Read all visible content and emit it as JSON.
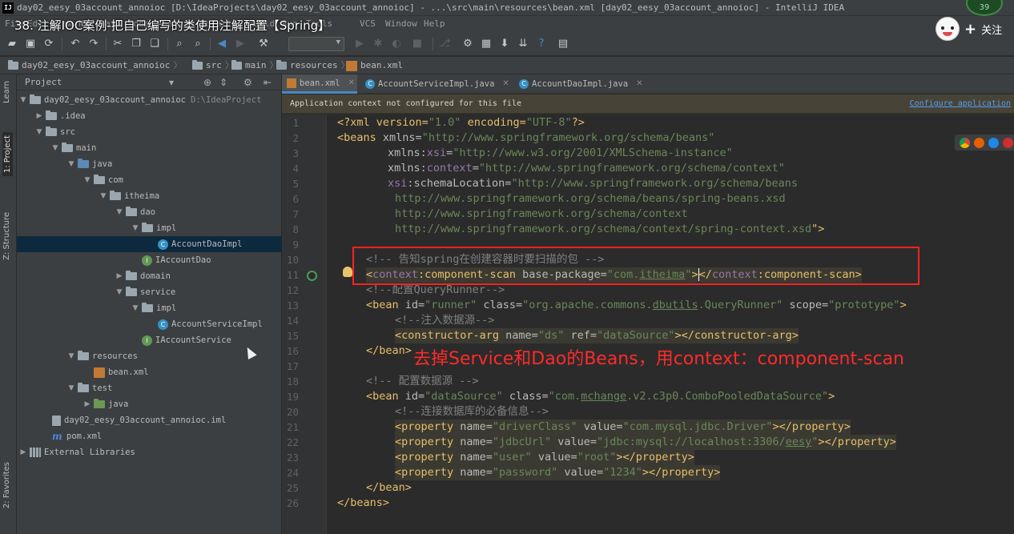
{
  "window": {
    "title": "day02_eesy_03account_annoioc [D:\\IdeaProjects\\day02_eesy_03account_annoioc] - ...\\src\\main\\resources\\bean.xml [day02_eesy_03account_annoioc] - IntelliJ IDEA"
  },
  "video": {
    "title": "38. 注解IOC案例-把自己编写的类使用注解配置【Spring】",
    "follow_plus": "+",
    "follow_label": "关注",
    "badge": "39"
  },
  "menu": [
    "File",
    "Edit",
    "View",
    "Navigate",
    "Code",
    "Analyze",
    "Refactor",
    "Build",
    "Run",
    "Tools",
    "VCS",
    "Window",
    "Help"
  ],
  "breadcrumb": [
    "day02_eesy_03account_annoioc",
    "src",
    "main",
    "resources",
    "bean.xml"
  ],
  "side_tabs": {
    "learn": "Learn",
    "project": "1: Project",
    "structure": "Z: Structure",
    "favorites": "2: Favorites"
  },
  "project_panel": {
    "title": "Project",
    "tree": [
      {
        "label": "day02_eesy_03account_annoioc",
        "path": "D:\\IdeaProject"
      },
      {
        "label": ".idea"
      },
      {
        "label": "src"
      },
      {
        "label": "main"
      },
      {
        "label": "java"
      },
      {
        "label": "com"
      },
      {
        "label": "itheima"
      },
      {
        "label": "dao"
      },
      {
        "label": "impl"
      },
      {
        "label": "AccountDaoImpl"
      },
      {
        "label": "IAccountDao"
      },
      {
        "label": "domain"
      },
      {
        "label": "service"
      },
      {
        "label": "impl"
      },
      {
        "label": "AccountServiceImpl"
      },
      {
        "label": "IAccountService"
      },
      {
        "label": "resources"
      },
      {
        "label": "bean.xml"
      },
      {
        "label": "test"
      },
      {
        "label": "java"
      },
      {
        "label": "day02_eesy_03account_annoioc.iml"
      },
      {
        "label": "pom.xml"
      },
      {
        "label": "External Libraries"
      }
    ]
  },
  "editor": {
    "tabs": [
      "bean.xml",
      "AccountServiceImpl.java",
      "AccountDaoImpl.java"
    ],
    "notification": "Application context not configured for this file",
    "notification_link": "Configure application",
    "line_numbers": [
      "1",
      "2",
      "3",
      "4",
      "5",
      "6",
      "7",
      "8",
      "9",
      "10",
      "11",
      "12",
      "13",
      "14",
      "15",
      "16",
      "17",
      "18",
      "19",
      "20",
      "21",
      "22",
      "23",
      "24",
      "25",
      "26"
    ],
    "code": {
      "l1": [
        "<?xml version=",
        "\"1.0\"",
        " encoding=",
        "\"UTF-8\"",
        "?>"
      ],
      "l2": [
        "<beans ",
        "xmlns",
        "=",
        "\"http://www.springframework.org/schema/beans\""
      ],
      "l3": [
        "xmlns",
        ":",
        "xsi",
        "=",
        "\"http://www.w3.org/2001/XMLSchema-instance\""
      ],
      "l4": [
        "xmlns",
        ":",
        "context",
        "=",
        "\"http://www.springframework.org/schema/context\""
      ],
      "l5": [
        "xsi",
        ":schemaLocation=",
        "\"http://www.springframework.org/schema/beans"
      ],
      "l6": "http://www.springframework.org/schema/beans/spring-beans.xsd",
      "l7": "http://www.springframework.org/schema/context",
      "l8": [
        "http://www.springframework.org/schema/context/spring-context.xsd",
        "\">"
      ],
      "l10": "<!-- 告知spring在创建容器时要扫描的包 -->",
      "l11": [
        "<",
        "context",
        ":component-scan ",
        "base-package=",
        "\"com.",
        "itheima",
        "\"",
        ">",
        "</",
        "context",
        ":component-scan>"
      ],
      "l12": "<!--配置QueryRunner-->",
      "l13": [
        "<bean ",
        "id=",
        "\"runner\"",
        " class=",
        "\"org.apache.commons.",
        "dbutils",
        ".QueryRunner\"",
        " scope=",
        "\"prototype\"",
        ">"
      ],
      "l14": "<!--注入数据源-->",
      "l15": [
        "<constructor-arg ",
        "name=",
        "\"ds\"",
        " ref=",
        "\"dataSource\"",
        "></constructor-arg>"
      ],
      "l16": "</bean>",
      "l18": "<!-- 配置数据源 -->",
      "l19": [
        "<bean ",
        "id=",
        "\"dataSource\"",
        " class=",
        "\"com.",
        "mchange",
        ".v2.c3p0.ComboPooledDataSource\"",
        ">"
      ],
      "l20": "<!--连接数据库的必备信息-->",
      "l21": [
        "<property ",
        "name=",
        "\"driverClass\"",
        " value=",
        "\"com.mysql.jdbc.Driver\"",
        "></property>"
      ],
      "l22": [
        "<property ",
        "name=",
        "\"jdbcUrl\"",
        " value=",
        "\"jdbc:mysql://localhost:3306/",
        "eesy",
        "\"",
        "></property>"
      ],
      "l23": [
        "<property ",
        "name=",
        "\"user\"",
        " value=",
        "\"root\"",
        "></property>"
      ],
      "l24": [
        "<property ",
        "name=",
        "\"password\"",
        " value=",
        "\"1234\"",
        "></property>"
      ],
      "l25": "</bean>",
      "l26": "</beans>"
    }
  },
  "annotation": "去掉Service和Dao的Beans，用context：component-scan"
}
